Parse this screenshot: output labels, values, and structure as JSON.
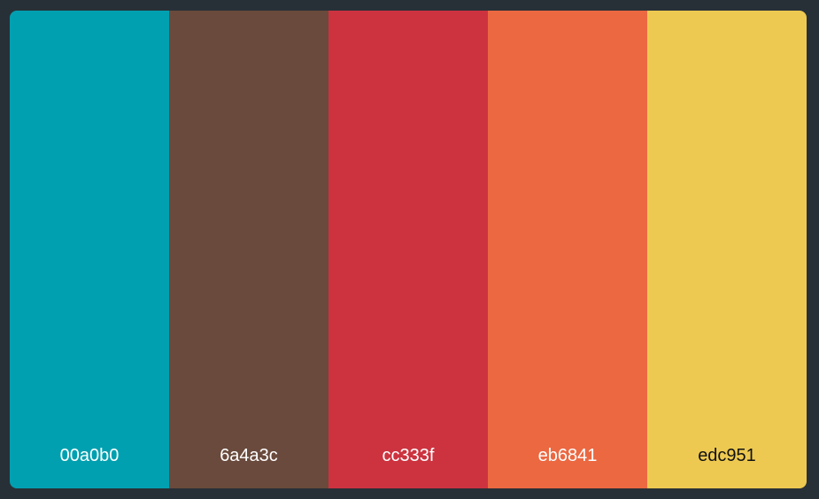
{
  "palette": {
    "swatches": [
      {
        "hex": "00a0b0",
        "color": "#00a0b0",
        "text_color": "#ffffff"
      },
      {
        "hex": "6a4a3c",
        "color": "#6a4a3c",
        "text_color": "#ffffff"
      },
      {
        "hex": "cc333f",
        "color": "#cc333f",
        "text_color": "#ffffff"
      },
      {
        "hex": "eb6841",
        "color": "#eb6841",
        "text_color": "#ffffff"
      },
      {
        "hex": "edc951",
        "color": "#edc951",
        "text_color": "#111111"
      }
    ]
  },
  "page_background": "#283037"
}
